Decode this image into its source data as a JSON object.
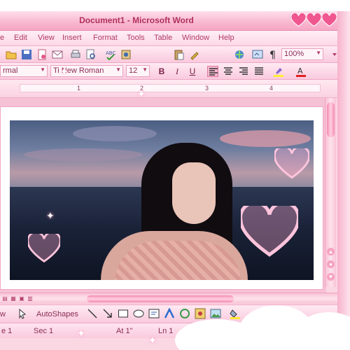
{
  "window": {
    "title": "Document1 - Microsoft Word"
  },
  "menu": [
    "e",
    "Edit",
    "View",
    "Insert",
    "Format",
    "Tools",
    "Table",
    "Window",
    "Help"
  ],
  "toolbar": {
    "zoom": "100%"
  },
  "formatting": {
    "style": "rmal",
    "font": "Ti    New Roman",
    "size": "12",
    "bold": "B",
    "italic": "I",
    "underline": "U"
  },
  "ruler": {
    "numbers": [
      "1",
      "2",
      "3",
      "4"
    ]
  },
  "drawing_toolbar": {
    "draw_label": "w",
    "autoshapes_label": "AutoShapes"
  },
  "status": {
    "page": "e 1",
    "section": "Sec 1",
    "at": "At 1\"",
    "line": "Ln 1"
  },
  "colors": {
    "accent": "#f48ab0",
    "title_text": "#b0305e",
    "chrome": "#fbd6e3"
  }
}
